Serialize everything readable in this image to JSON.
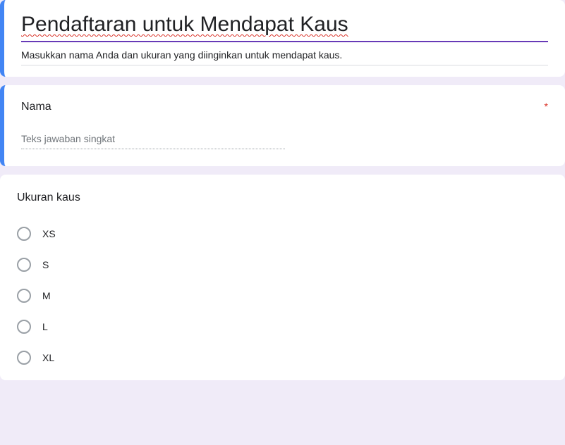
{
  "header": {
    "title": "Pendaftaran untuk Mendapat Kaus",
    "description": "Masukkan nama Anda dan ukuran yang diinginkan untuk mendapat kaus."
  },
  "questions": [
    {
      "title": "Nama",
      "required": true,
      "required_marker": "*",
      "placeholder": "Teks jawaban singkat"
    },
    {
      "title": "Ukuran kaus",
      "required": false,
      "options": [
        "XS",
        "S",
        "M",
        "L",
        "XL"
      ]
    }
  ]
}
